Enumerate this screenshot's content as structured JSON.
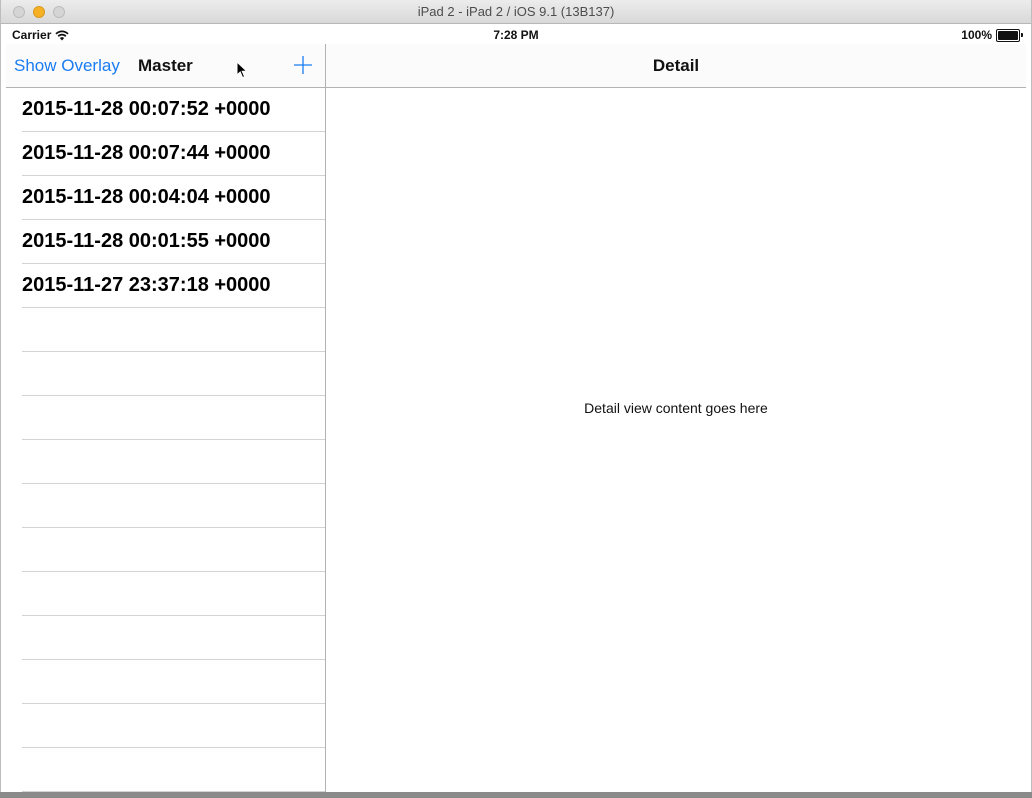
{
  "window": {
    "title": "iPad 2 - iPad 2 / iOS 9.1 (13B137)"
  },
  "statusbar": {
    "carrier": "Carrier",
    "time": "7:28 PM",
    "battery": "100%",
    "battery_level": 1.0
  },
  "master": {
    "overlay_button": "Show Overlay",
    "title": "Master",
    "rows": [
      "2015-11-28 00:07:52 +0000",
      "2015-11-28 00:07:44 +0000",
      "2015-11-28 00:04:04 +0000",
      "2015-11-28 00:01:55 +0000",
      "2015-11-27 23:37:18 +0000"
    ]
  },
  "detail": {
    "title": "Detail",
    "content": "Detail view content goes here"
  },
  "colors": {
    "accent": "#1a7cf2",
    "separator": "#d3d3d3"
  }
}
